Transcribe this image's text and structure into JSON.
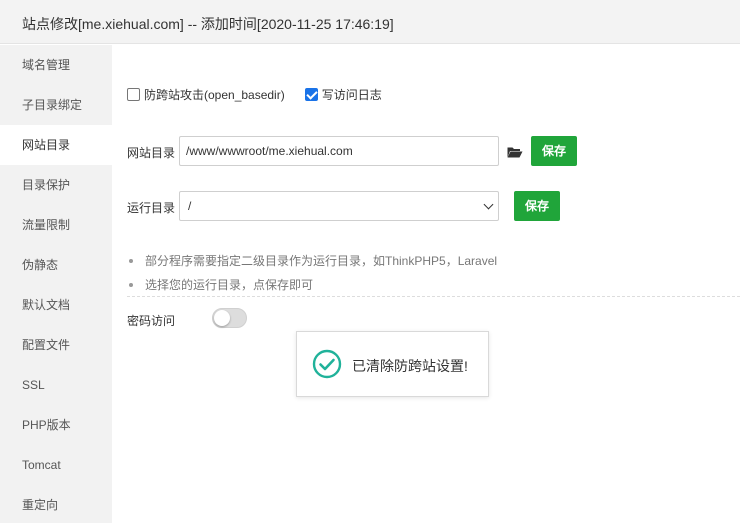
{
  "window": {
    "title": "站点修改[me.xiehual.com] -- 添加时间[2020-11-25 17:46:19]"
  },
  "sidebar": {
    "items": [
      {
        "label": "域名管理"
      },
      {
        "label": "子目录绑定"
      },
      {
        "label": "网站目录"
      },
      {
        "label": "目录保护"
      },
      {
        "label": "流量限制"
      },
      {
        "label": "伪静态"
      },
      {
        "label": "默认文档"
      },
      {
        "label": "配置文件"
      },
      {
        "label": "SSL"
      },
      {
        "label": "PHP版本"
      },
      {
        "label": "Tomcat"
      },
      {
        "label": "重定向"
      }
    ],
    "active": "网站目录"
  },
  "main": {
    "options": {
      "open_basedir_label": "防跨站攻击(open_basedir)",
      "open_basedir_checked": false,
      "access_log_label": "写访问日志",
      "access_log_checked": true
    },
    "site_dir": {
      "label": "网站目录",
      "value": "/www/wwwroot/me.xiehual.com",
      "save_label": "保存"
    },
    "run_dir": {
      "label": "运行目录",
      "value": "/",
      "save_label": "保存"
    },
    "tips": [
      "部分程序需要指定二级目录作为运行目录，如ThinkPHP5，Laravel",
      "选择您的运行目录，点保存即可"
    ],
    "password_access": {
      "label": "密码访问",
      "enabled": false
    }
  },
  "toast": {
    "message": "已清除防跨站设置!"
  },
  "colors": {
    "accent": "#20a53a",
    "checkbox": "#1a73e8",
    "success_icon": "#20b29a"
  },
  "icons": {
    "folder": "folder-open-icon",
    "success": "check-circle-icon"
  }
}
